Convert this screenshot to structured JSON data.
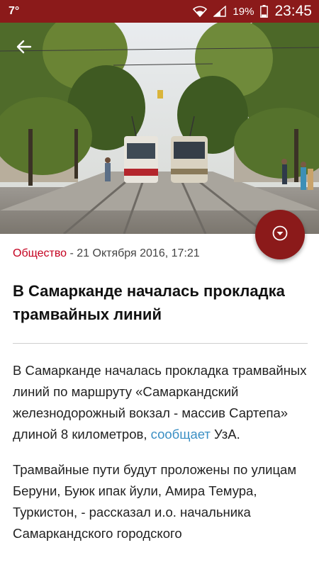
{
  "status_bar": {
    "left_indicator": "7°",
    "battery": "19%",
    "time": "23:45",
    "icons": [
      "wifi-icon",
      "signal-icon",
      "battery-icon"
    ]
  },
  "colors": {
    "brand": "#8b1a1a",
    "category": "#c4001f",
    "link": "#3a8fc4"
  },
  "hero": {
    "icons": [
      "back-arrow-icon"
    ]
  },
  "fab": {
    "icon": "chevron-down-circle-icon"
  },
  "article": {
    "category": "Общество",
    "separator": " - ",
    "date": "21 Октября 2016, 17:21",
    "title": "В Самарканде началась прокладка трамвайных линий",
    "para1_text": "В Самарканде началась прокладка трамвайных линий по маршруту «Самаркандский железнодорожный вокзал - массив Сартепа» длиной 8 километров, ",
    "para1_link": "сообщает",
    "para1_tail": " УзА.",
    "para2_text": "Трамвайные пути будут проложены по улицам Беруни, Буюк ипак йули, Амира Темура, Туркистон, - рассказал и.о. начальника Самаркандского городского"
  }
}
